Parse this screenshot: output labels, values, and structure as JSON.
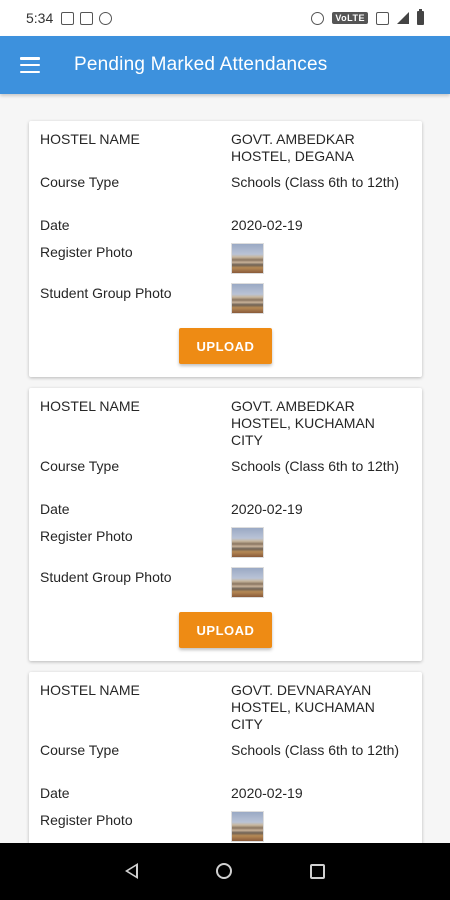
{
  "status_bar": {
    "time": "5:34",
    "network_label": "VoLTE"
  },
  "app_bar": {
    "title": "Pending Marked Attendances"
  },
  "labels": {
    "hostel_name": "HOSTEL NAME",
    "course_type": "Course Type",
    "date": "Date",
    "register_photo": "Register Photo",
    "student_group_photo": "Student Group Photo",
    "upload": "UPLOAD"
  },
  "cards": [
    {
      "hostel_name": "GOVT. AMBEDKAR HOSTEL, DEGANA",
      "course_type": "Schools (Class 6th to 12th)",
      "date": "2020-02-19"
    },
    {
      "hostel_name": "GOVT. AMBEDKAR HOSTEL, KUCHAMAN CITY",
      "course_type": "Schools (Class 6th to 12th)",
      "date": "2020-02-19"
    },
    {
      "hostel_name": "GOVT. DEVNARAYAN HOSTEL, KUCHAMAN CITY",
      "course_type": "Schools (Class 6th to 12th)",
      "date": "2020-02-19"
    }
  ],
  "colors": {
    "app_bar": "#3d91dd",
    "upload_button": "#ee8b14",
    "nav_bar": "#000000"
  }
}
